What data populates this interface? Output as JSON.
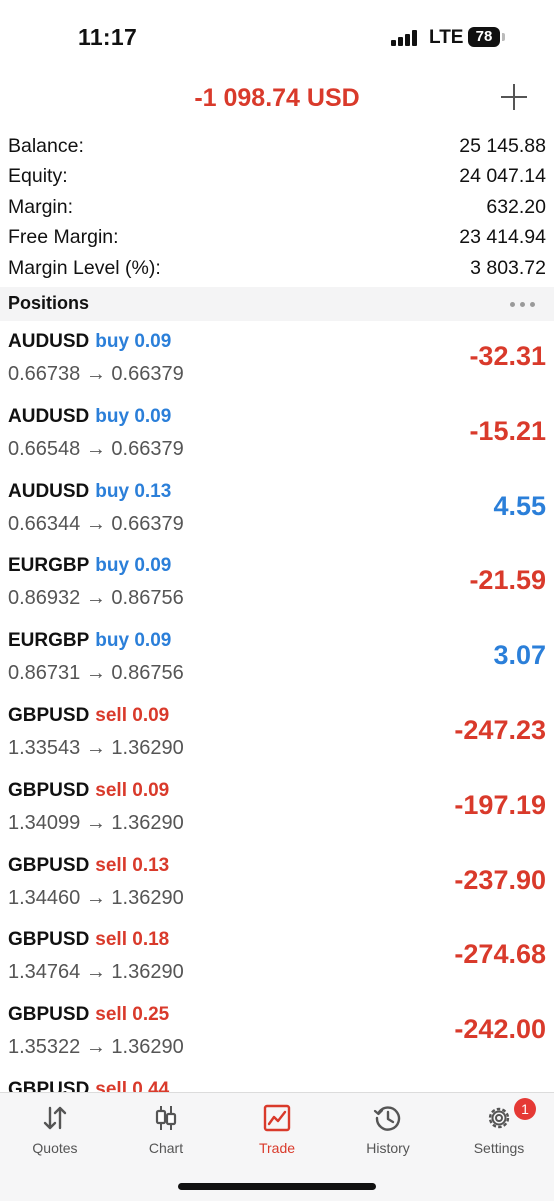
{
  "status_bar": {
    "time": "11:17",
    "network": "LTE",
    "battery": "78"
  },
  "header": {
    "total_profit": "-1 098.74 USD",
    "add_icon": "plus-icon"
  },
  "summary": [
    {
      "label": "Balance:",
      "value": "25 145.88"
    },
    {
      "label": "Equity:",
      "value": "24 047.14"
    },
    {
      "label": "Margin:",
      "value": "632.20"
    },
    {
      "label": "Free Margin:",
      "value": "23 414.94"
    },
    {
      "label": "Margin Level (%):",
      "value": "3 803.72"
    }
  ],
  "positions": {
    "title": "Positions",
    "more_icon": "more-dots-icon",
    "items": [
      {
        "symbol": "AUDUSD",
        "side": "buy 0.09",
        "prices": "0.66738 → 0.66379",
        "profit": "-32.31"
      },
      {
        "symbol": "AUDUSD",
        "side": "buy 0.09",
        "prices": "0.66548 → 0.66379",
        "profit": "-15.21"
      },
      {
        "symbol": "AUDUSD",
        "side": "buy 0.13",
        "prices": "0.66344 → 0.66379",
        "profit": "4.55"
      },
      {
        "symbol": "EURGBP",
        "side": "buy 0.09",
        "prices": "0.86932 → 0.86756",
        "profit": "-21.59"
      },
      {
        "symbol": "EURGBP",
        "side": "buy 0.09",
        "prices": "0.86731 → 0.86756",
        "profit": "3.07"
      },
      {
        "symbol": "GBPUSD",
        "side": "sell 0.09",
        "prices": "1.33543 → 1.36290",
        "profit": "-247.23"
      },
      {
        "symbol": "GBPUSD",
        "side": "sell 0.09",
        "prices": "1.34099 → 1.36290",
        "profit": "-197.19"
      },
      {
        "symbol": "GBPUSD",
        "side": "sell 0.13",
        "prices": "1.34460 → 1.36290",
        "profit": "-237.90"
      },
      {
        "symbol": "GBPUSD",
        "side": "sell 0.18",
        "prices": "1.34764 → 1.36290",
        "profit": "-274.68"
      },
      {
        "symbol": "GBPUSD",
        "side": "sell 0.25",
        "prices": "1.35322 → 1.36290",
        "profit": "-242.00"
      },
      {
        "symbol": "GBPUSD",
        "side": "sell 0.44",
        "prices": "",
        "profit": ""
      }
    ]
  },
  "tabs": [
    {
      "label": "Quotes",
      "icon": "quotes-arrows-icon"
    },
    {
      "label": "Chart",
      "icon": "candlestick-chart-icon"
    },
    {
      "label": "Trade",
      "icon": "trade-chart-icon",
      "active": true
    },
    {
      "label": "History",
      "icon": "history-clock-icon"
    },
    {
      "label": "Settings",
      "icon": "gear-icon",
      "badge": "1"
    }
  ],
  "colors": {
    "loss": "#d93a2b",
    "gain": "#2b7fd9",
    "buy": "#2b7fd9",
    "sell": "#d93a2b"
  }
}
